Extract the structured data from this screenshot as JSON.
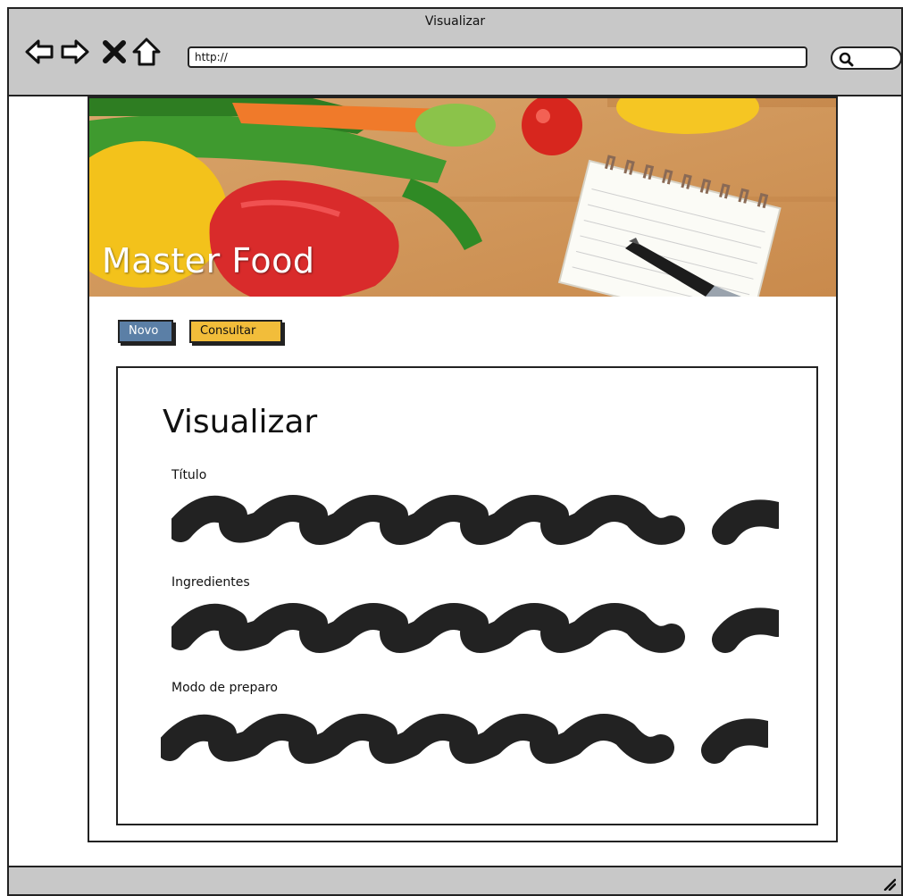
{
  "window": {
    "title": "Visualizar",
    "url": "http://"
  },
  "icons": {
    "back": "back-arrow-icon",
    "forward": "forward-arrow-icon",
    "stop": "close-icon",
    "home": "home-icon",
    "search": "search-icon",
    "resize": "resize-grip-icon"
  },
  "brand": {
    "name": "Master Food"
  },
  "buttons": {
    "novo": "Novo",
    "consultar": "Consultar"
  },
  "panel": {
    "title": "Visualizar",
    "fields": [
      {
        "label": "Título"
      },
      {
        "label": "Ingredientes"
      },
      {
        "label": "Modo de preparo"
      }
    ]
  },
  "colors": {
    "chrome": "#c8c8c8",
    "novo": "#5b7fa6",
    "consultar": "#f2bd3a",
    "ink": "#222222"
  }
}
